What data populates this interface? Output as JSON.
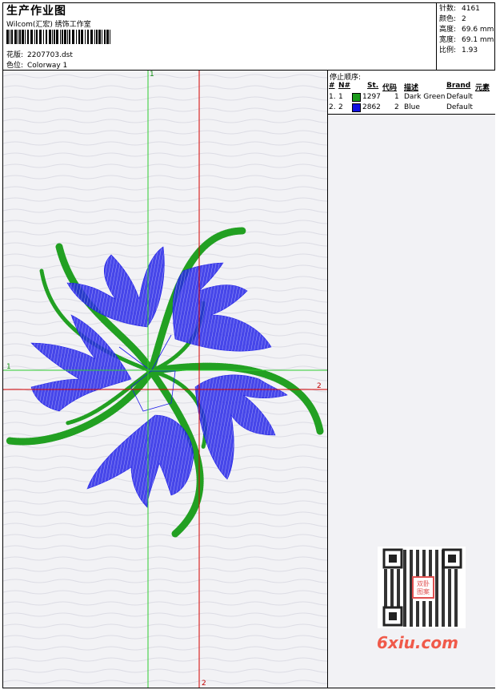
{
  "header": {
    "title": "生产作业图",
    "studio": "Wilcom(汇宏) 绣饰工作室",
    "design_label": "花版:",
    "design_value": "2207703.dst",
    "colorway_label": "色位:",
    "colorway_value": "Colorway 1"
  },
  "stats": [
    {
      "label": "针数:",
      "value": "4161"
    },
    {
      "label": "颜色:",
      "value": "2"
    },
    {
      "label": "高度:",
      "value": "69.6 mm"
    },
    {
      "label": "宽度:",
      "value": "69.1 mm"
    },
    {
      "label": "比例:",
      "value": "1.93"
    }
  ],
  "axes": {
    "green_top": "1",
    "green_left": "1",
    "red_right": "2",
    "red_bottom": "2"
  },
  "stop_sequence": {
    "title": "停止顺序:",
    "columns": [
      "#",
      "N#",
      "St.",
      "代码",
      "描述",
      "Brand",
      "元素"
    ],
    "rows": [
      {
        "idx": "1.",
        "n": "1",
        "color": "#1a9a1a",
        "stitches": "1297",
        "code": "1",
        "desc": "Dark Green",
        "brand": "Default"
      },
      {
        "idx": "2.",
        "n": "2",
        "color": "#1010e0",
        "stitches": "2862",
        "code": "2",
        "desc": "Blue",
        "brand": "Default"
      }
    ]
  },
  "watermark": {
    "qr_stamp": "双卧图案",
    "site": "6xiu.com"
  },
  "colors": {
    "green_thread": "#22a022",
    "blue_thread": "#1a1ae8",
    "axis_green": "#2ecc2e",
    "axis_red": "#d40000"
  }
}
